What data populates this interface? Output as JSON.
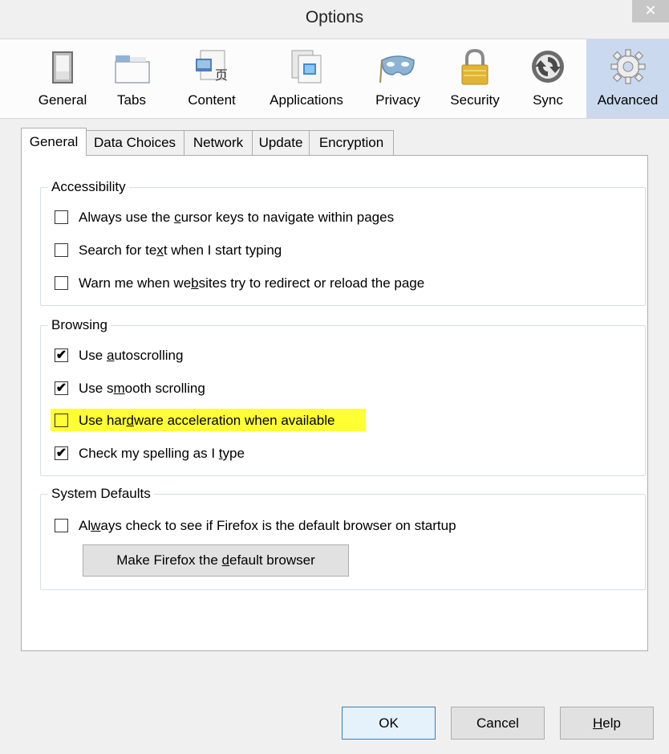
{
  "window": {
    "title": "Options",
    "close_glyph": "✕"
  },
  "toolbar": {
    "panes": [
      {
        "label": "General",
        "icon": "switch-icon",
        "selected": false
      },
      {
        "label": "Tabs",
        "icon": "tabs-icon",
        "selected": false
      },
      {
        "label": "Content",
        "icon": "content-icon",
        "selected": false
      },
      {
        "label": "Applications",
        "icon": "applications-icon",
        "selected": false
      },
      {
        "label": "Privacy",
        "icon": "mask-icon",
        "selected": false
      },
      {
        "label": "Security",
        "icon": "padlock-icon",
        "selected": false
      },
      {
        "label": "Sync",
        "icon": "sync-icon",
        "selected": false
      },
      {
        "label": "Advanced",
        "icon": "gear-icon",
        "selected": true
      }
    ]
  },
  "tabs": [
    {
      "label": "General",
      "active": true
    },
    {
      "label": "Data Choices",
      "active": false
    },
    {
      "label": "Network",
      "active": false
    },
    {
      "label": "Update",
      "active": false
    },
    {
      "label": "Encryption",
      "active": false
    }
  ],
  "accessibility": {
    "caption": "Accessibility",
    "options": [
      {
        "pre": "Always use the ",
        "key": "c",
        "post": "ursor keys to navigate within pages",
        "checked": false
      },
      {
        "pre": "Search for te",
        "key": "x",
        "post": "t when I start typing",
        "checked": false
      },
      {
        "pre": "Warn me when we",
        "key": "b",
        "post": "sites try to redirect or reload the page",
        "checked": false
      }
    ]
  },
  "browsing": {
    "caption": "Browsing",
    "options": [
      {
        "pre": "Use ",
        "key": "a",
        "post": "utoscrolling",
        "checked": true
      },
      {
        "pre": "Use s",
        "key": "m",
        "post": "ooth scrolling",
        "checked": true
      },
      {
        "pre": "Use har",
        "key": "d",
        "post": "ware acceleration when available",
        "checked": false,
        "highlighted": true
      },
      {
        "pre": "Check my spelling as I ",
        "key": "t",
        "post": "ype",
        "checked": true
      }
    ]
  },
  "system_defaults": {
    "caption": "System Defaults",
    "option": {
      "pre": "Al",
      "key": "w",
      "post": "ays check to see if Firefox is the default browser on startup",
      "checked": false
    },
    "make_default_button": {
      "pre": "Make Firefox the ",
      "key": "d",
      "post": "efault browser"
    }
  },
  "footer": {
    "ok_label": "OK",
    "cancel_label": "Cancel",
    "help": {
      "key": "H",
      "post": "elp"
    }
  },
  "colors": {
    "highlight": "#ffff33",
    "selected_pane": "#cbd9ee",
    "default_button_border": "#3c7fb1"
  }
}
